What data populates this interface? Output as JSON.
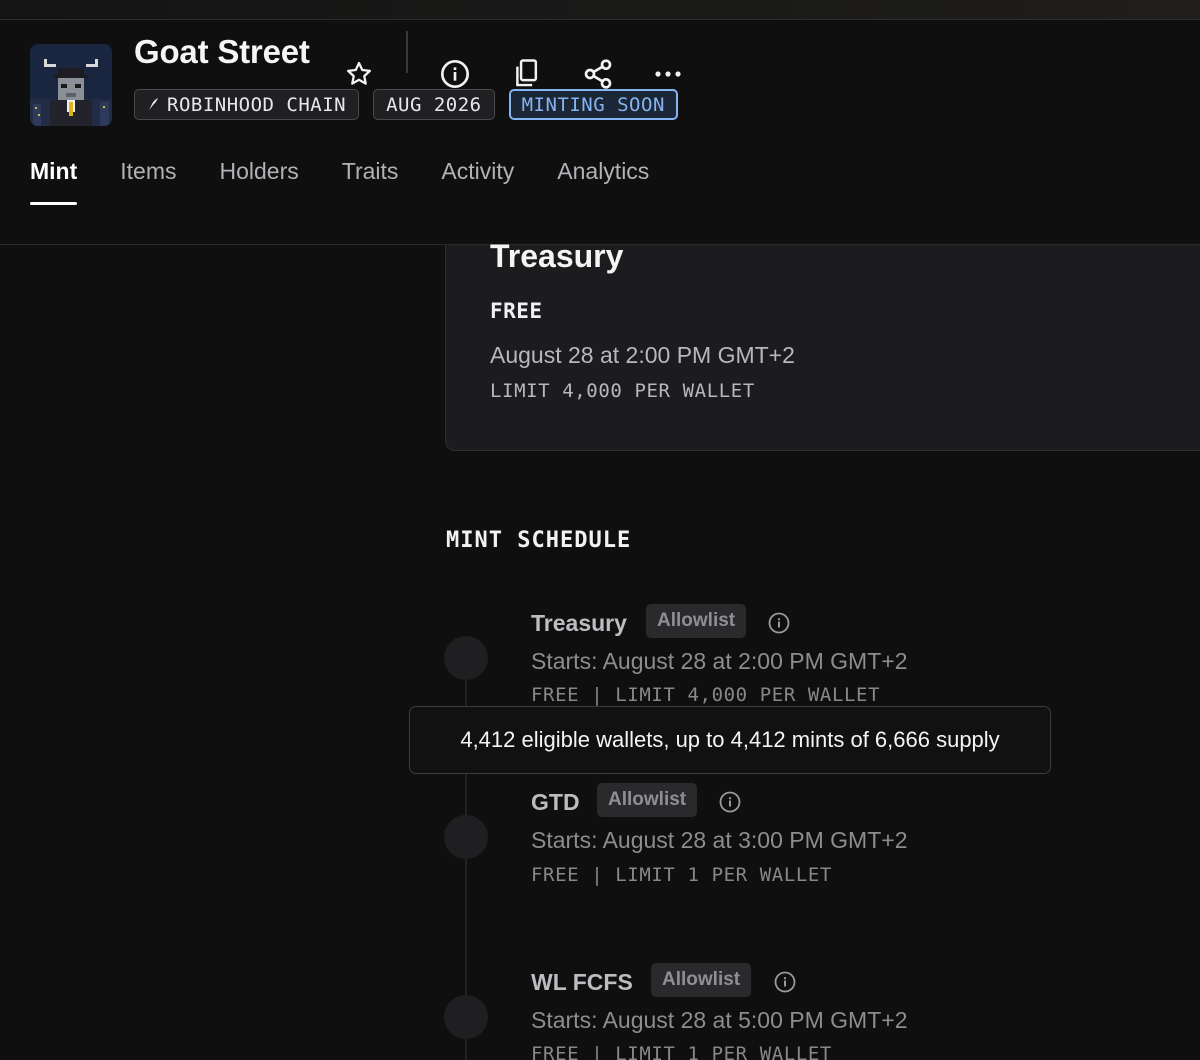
{
  "collection": {
    "title": "Goat Street",
    "badges": [
      {
        "label": "ROBINHOOD CHAIN",
        "icon": "feather-icon"
      },
      {
        "label": "AUG 2026"
      },
      {
        "label": "MINTING SOON",
        "accent": "#86b4f0"
      }
    ]
  },
  "header_actions": [
    "favorite-star-icon",
    "info-icon",
    "copy-icon",
    "share-icon",
    "more-icon"
  ],
  "tabs": [
    {
      "label": "Mint",
      "active": true
    },
    {
      "label": "Items"
    },
    {
      "label": "Holders"
    },
    {
      "label": "Traits"
    },
    {
      "label": "Activity"
    },
    {
      "label": "Analytics"
    }
  ],
  "current_phase": {
    "name": "Treasury",
    "price": "FREE",
    "date": "August 28 at 2:00 PM GMT+2",
    "limit": "LIMIT 4,000 PER WALLET"
  },
  "schedule": {
    "title": "MINT SCHEDULE",
    "phases": [
      {
        "name": "Treasury",
        "tag": "Allowlist",
        "start": "Starts: August 28 at 2:00 PM GMT+2",
        "meta": "FREE | LIMIT 4,000 PER WALLET"
      },
      {
        "name": "GTD",
        "tag": "Allowlist",
        "start": "Starts: August 28 at 3:00 PM GMT+2",
        "meta": "FREE | LIMIT 1 PER WALLET"
      },
      {
        "name": "WL FCFS",
        "tag": "Allowlist",
        "start": "Starts: August 28 at 5:00 PM GMT+2",
        "meta": "FREE | LIMIT 1 PER WALLET"
      }
    ]
  },
  "tooltip": {
    "text": "4,412 eligible wallets, up to 4,412 mints of 6,666 supply"
  },
  "colors": {
    "background": "#0f0f10",
    "card": "#1c1c1e",
    "accent": "#86b4f0"
  }
}
